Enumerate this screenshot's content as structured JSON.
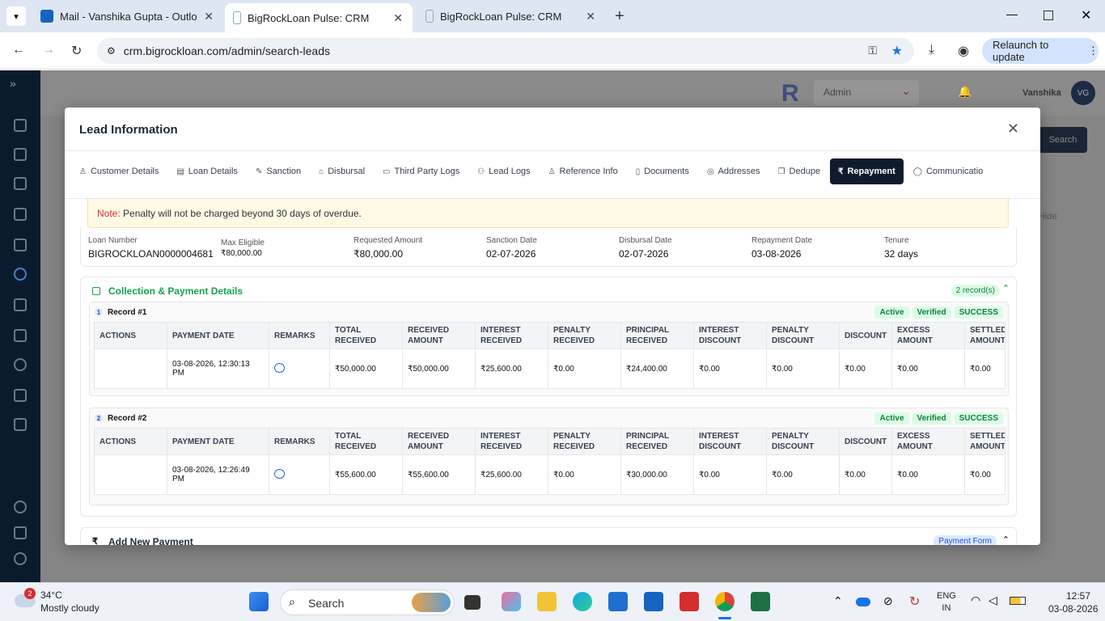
{
  "browser": {
    "tabs": [
      {
        "title": "Mail - Vanshika Gupta - Outlo",
        "active": false
      },
      {
        "title": "BigRockLoan Pulse: CRM",
        "active": true
      },
      {
        "title": "BigRockLoan Pulse: CRM",
        "active": false
      }
    ],
    "url": "crm.bigrockloan.com/admin/search-leads",
    "relaunch_label": "Relaunch to update"
  },
  "app_header": {
    "role_select": "Admin",
    "user_name": "Vanshika",
    "avatar_initials": "VG",
    "search_button": "Search",
    "hide_label": "Hide"
  },
  "modal": {
    "title": "Lead Information",
    "tabs": [
      {
        "label": "Customer Details",
        "icon": "user-icon"
      },
      {
        "label": "Loan Details",
        "icon": "loan-icon"
      },
      {
        "label": "Sanction",
        "icon": "edit-icon"
      },
      {
        "label": "Disbursal",
        "icon": "bank-icon"
      },
      {
        "label": "Third Party Logs",
        "icon": "document-icon"
      },
      {
        "label": "Lead Logs",
        "icon": "users-icon"
      },
      {
        "label": "Reference Info",
        "icon": "user-plus-icon"
      },
      {
        "label": "Documents",
        "icon": "file-icon"
      },
      {
        "label": "Addresses",
        "icon": "location-icon"
      },
      {
        "label": "Dedupe",
        "icon": "copy-icon"
      },
      {
        "label": "Repayment",
        "icon": "rupee-icon"
      },
      {
        "label": "Communicatio",
        "icon": "chat-icon"
      }
    ],
    "note": {
      "label": "Note:",
      "text": "Penalty will not be charged beyond 30 days of overdue."
    },
    "summary": {
      "loan_number_label": "Loan Number",
      "loan_number": "BIGROCKLOAN0000004681",
      "max_eligible_label": "Max Eligible",
      "max_eligible": "₹80,000.00",
      "requested_amount_label": "Requested Amount",
      "requested_amount": "₹80,000.00",
      "sanction_date_label": "Sanction Date",
      "sanction_date": "02-07-2026",
      "disbursal_date_label": "Disbursal Date",
      "disbursal_date": "02-07-2026",
      "repayment_date_label": "Repayment Date",
      "repayment_date": "03-08-2026",
      "tenure_label": "Tenure",
      "tenure": "32 days"
    },
    "collection": {
      "title": "Collection & Payment Details",
      "records_badge": "2 record(s)",
      "columns": [
        "ACTIONS",
        "PAYMENT DATE",
        "REMARKS",
        "TOTAL RECEIVED",
        "RECEIVED AMOUNT",
        "INTEREST RECEIVED",
        "PENALTY RECEIVED",
        "PRINCIPAL RECEIVED",
        "INTEREST DISCOUNT",
        "PENALTY DISCOUNT",
        "DISCOUNT",
        "EXCESS AMOUNT",
        "SETTLED AMOUNT"
      ],
      "records": [
        {
          "num": "1",
          "title": "Record #1",
          "tags": [
            "Active",
            "Verified",
            "SUCCESS"
          ],
          "row": [
            "",
            "03-08-2026, 12:30:13 PM",
            "",
            "₹50,000.00",
            "₹50,000.00",
            "₹25,600.00",
            "₹0.00",
            "₹24,400.00",
            "₹0.00",
            "₹0.00",
            "₹0.00",
            "₹0.00",
            "₹0.00"
          ]
        },
        {
          "num": "2",
          "title": "Record #2",
          "tags": [
            "Active",
            "Verified",
            "SUCCESS"
          ],
          "row": [
            "",
            "03-08-2026, 12:26:49 PM",
            "",
            "₹55,600.00",
            "₹55,600.00",
            "₹25,600.00",
            "₹0.00",
            "₹30,000.00",
            "₹0.00",
            "₹0.00",
            "₹0.00",
            "₹0.00",
            "₹0.00"
          ]
        }
      ]
    },
    "add_payment": {
      "title": "Add New Payment",
      "badge": "Payment Form"
    }
  },
  "taskbar": {
    "weather_temp": "34°C",
    "weather_desc": "Mostly cloudy",
    "weather_badge": "2",
    "search_label": "Search",
    "lang_line1": "ENG",
    "lang_line2": "IN",
    "time": "12:57",
    "date": "03-08-2026"
  },
  "colors": {
    "accent_dark": "#0f1b2d",
    "success_green": "#16a34a",
    "note_bg": "#fff9e6"
  }
}
